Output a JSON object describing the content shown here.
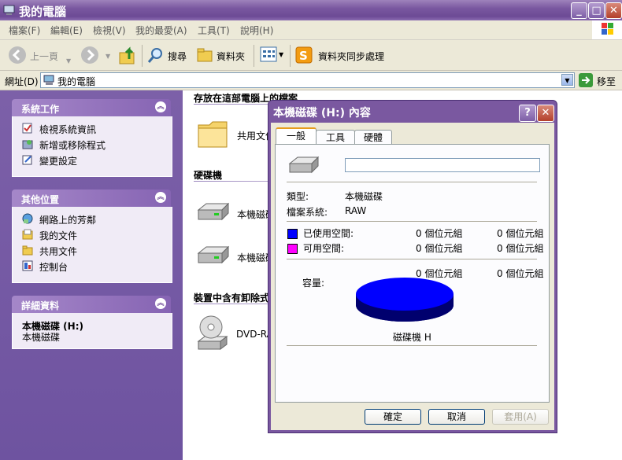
{
  "window": {
    "title": "我的電腦",
    "buttons": {
      "minimize": "_",
      "maximize": "□",
      "close": "✕"
    }
  },
  "menu": [
    "檔案(F)",
    "編輯(E)",
    "檢視(V)",
    "我的最愛(A)",
    "工具(T)",
    "說明(H)"
  ],
  "toolbar": {
    "back": "上一頁",
    "search": "搜尋",
    "folders": "資料夾",
    "sync": "資料夾同步處理"
  },
  "address": {
    "label": "網址(D)",
    "value": "我的電腦",
    "go": "移至"
  },
  "left_pane": {
    "system_tasks": {
      "title": "系統工作",
      "items": [
        "檢視系統資訊",
        "新增或移除程式",
        "變更設定"
      ]
    },
    "other_places": {
      "title": "其他位置",
      "items": [
        "網路上的芳鄰",
        "我的文件",
        "共用文件",
        "控制台"
      ]
    },
    "details": {
      "title": "詳細資料",
      "name": "本機磁碟 (H:)",
      "type": "本機磁碟"
    }
  },
  "content": {
    "files_section": "存放在這部電腦上的檔案",
    "shared_docs": "共用文件",
    "hdd_section": "硬碟機",
    "drive1": "本機磁碟",
    "drive2": "本機磁碟",
    "removable_section": "裝置中含有卸除式",
    "dvd": "DVD-RAM"
  },
  "dialog": {
    "title": "本機磁碟 (H:) 內容",
    "help": "?",
    "close": "✕",
    "tabs": [
      "一般",
      "工具",
      "硬體"
    ],
    "name_value": "",
    "type_label": "類型:",
    "type_value": "本機磁碟",
    "fs_label": "檔案系統:",
    "fs_value": "RAW",
    "used_label": "已使用空間:",
    "used_bytes": "0 個位元組",
    "used_size": "0 個位元組",
    "free_label": "可用空間:",
    "free_bytes": "0 個位元組",
    "free_size": "0 個位元組",
    "cap_label": "容量:",
    "cap_bytes": "0 個位元組",
    "cap_size": "0 個位元組",
    "drive_caption": "磁碟機 H",
    "ok": "確定",
    "cancel": "取消",
    "apply": "套用(A)",
    "colors": {
      "used": "#0000ff",
      "free": "#ff00ff"
    }
  }
}
